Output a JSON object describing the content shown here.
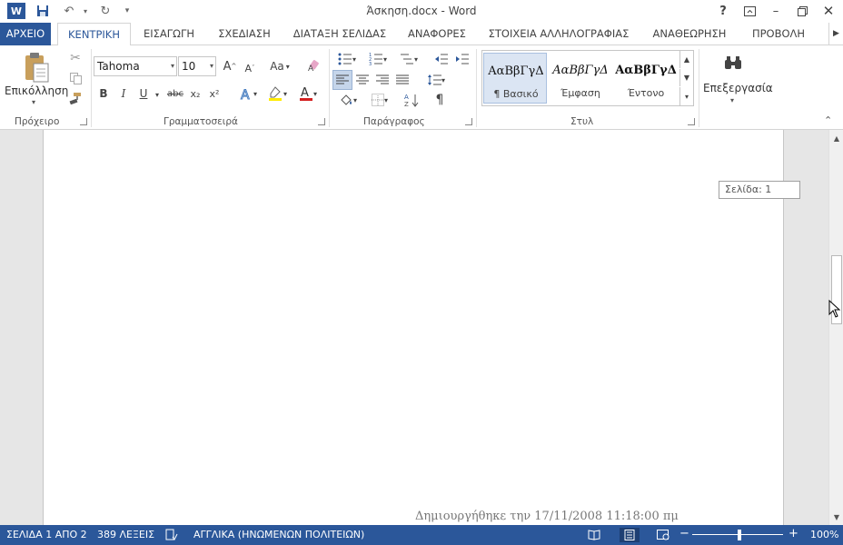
{
  "window": {
    "title": "Άσκηση.docx - Word"
  },
  "quick_access": {
    "word_logo": "W"
  },
  "window_controls": {
    "help": "?",
    "minimize": "–"
  },
  "tabs": [
    {
      "label": "ΑΡΧΕΙΟ"
    },
    {
      "label": "ΚΕΝΤΡΙΚΗ"
    },
    {
      "label": "ΕΙΣΑΓΩΓΗ"
    },
    {
      "label": "ΣΧΕΔΙΑΣΗ"
    },
    {
      "label": "ΔΙΑΤΑΞΗ ΣΕΛΙΔΑΣ"
    },
    {
      "label": "ΑΝΑΦΟΡΕΣ"
    },
    {
      "label": "ΣΤΟΙΧΕΙΑ ΑΛΛΗΛΟΓΡΑΦΙΑΣ"
    },
    {
      "label": "ΑΝΑΘΕΩΡΗΣΗ"
    },
    {
      "label": "ΠΡΟΒΟΛΗ"
    }
  ],
  "ribbon": {
    "clipboard": {
      "group_label": "Πρόχειρο",
      "paste_label": "Επικόλληση"
    },
    "font": {
      "group_label": "Γραμματοσειρά",
      "font_name": "Tahoma",
      "font_size": "10",
      "grow": "A",
      "shrink": "A",
      "change_case": "Aa",
      "bold": "B",
      "italic": "I",
      "underline": "U",
      "strikethrough": "abc",
      "subscript": "x₂",
      "superscript": "x²"
    },
    "paragraph": {
      "group_label": "Παράγραφος"
    },
    "styles": {
      "group_label": "Στυλ",
      "items": [
        {
          "preview": "ΑαΒβΓγΔ",
          "name": "¶ Βασικό"
        },
        {
          "preview": "ΑαΒβΓγΔ",
          "name": "Έμφαση"
        },
        {
          "preview": "ΑαΒβΓγΔ",
          "name": "Έντονο"
        }
      ]
    },
    "editing": {
      "label": "Επεξεργασία"
    }
  },
  "document": {
    "page_tooltip": "Σελίδα: 1",
    "footer_text": "Δημιουργήθηκε την 17/11/2008 11:18:00 πμ"
  },
  "statusbar": {
    "page": "ΣΕΛΙΔΑ 1 ΑΠΟ 2",
    "words": "389 ΛΕΞΕΙΣ",
    "language": "ΑΓΓΛΙΚΑ (ΗΝΩΜΕΝΩΝ ΠΟΛΙΤΕΙΩΝ)",
    "zoom": "100%",
    "zoom_minus": "−",
    "zoom_plus": "+"
  },
  "colors": {
    "accent": "#2b579a"
  }
}
